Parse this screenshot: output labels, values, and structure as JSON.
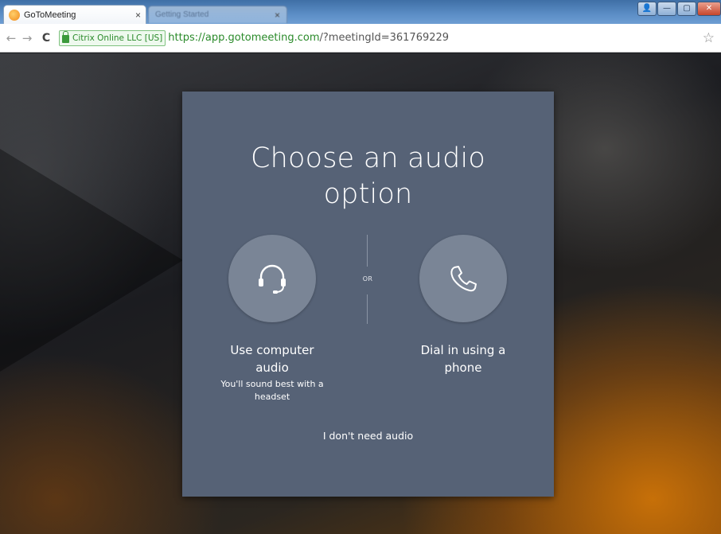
{
  "browser": {
    "active_tab": {
      "title": "GoToMeeting",
      "close": "×"
    },
    "inactive_tab": {
      "title": "Getting Started",
      "close": "×"
    },
    "window_controls": {
      "user": "👤",
      "minimize": "—",
      "maximize": "▢",
      "close": "✕"
    },
    "nav": {
      "back": "←",
      "forward": "→",
      "reload": "C"
    },
    "address": {
      "ev_label": "Citrix Online LLC [US]",
      "url_host": "https://app.gotomeeting.com",
      "url_path": "/?meetingId=361769229"
    },
    "bookmark_star": "☆"
  },
  "dialog": {
    "title_line1": "Choose an audio",
    "title_line2": "option",
    "divider_label": "OR",
    "computer_option": {
      "icon": "headset-icon",
      "label_line1": "Use computer",
      "label_line2": "audio",
      "hint_line1": "You'll sound best with a",
      "hint_line2": "headset"
    },
    "phone_option": {
      "icon": "phone-icon",
      "label_line1": "Dial in using a",
      "label_line2": "phone"
    },
    "no_audio_link": "I don't need audio"
  },
  "colors": {
    "dialog_bg": "#566276",
    "circle_bg": "#7a8596",
    "secure_green": "#2a8a2a",
    "accent_orange": "#cd7308"
  }
}
